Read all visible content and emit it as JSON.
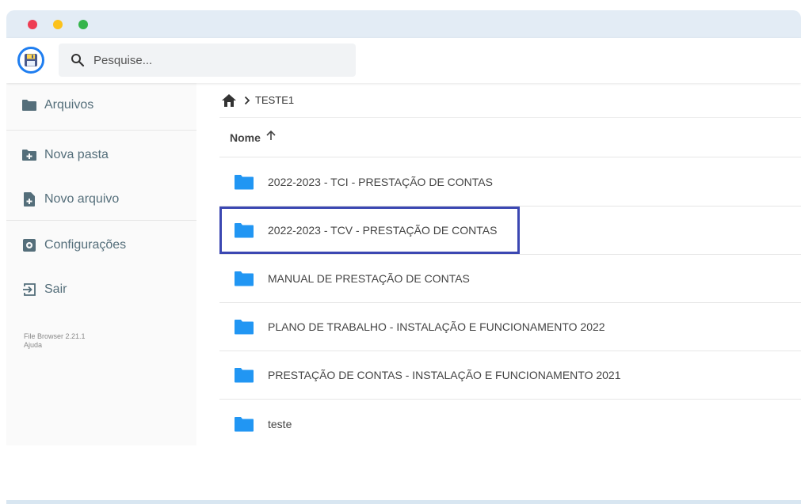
{
  "window": {
    "controls": [
      "close",
      "minimize",
      "maximize"
    ]
  },
  "header": {
    "logo_icon": "floppy-disk-icon",
    "search": {
      "icon": "search-icon",
      "placeholder": "Pesquise...",
      "value": ""
    }
  },
  "sidebar": {
    "items": [
      {
        "label": "Arquivos",
        "icon": "folder-icon"
      },
      {
        "label": "Nova pasta",
        "icon": "new-folder-icon"
      },
      {
        "label": "Novo arquivo",
        "icon": "new-file-icon"
      },
      {
        "label": "Configurações",
        "icon": "settings-icon"
      },
      {
        "label": "Sair",
        "icon": "exit-icon"
      }
    ],
    "credits": {
      "version": "File Browser 2.21.1",
      "help": "Ajuda"
    }
  },
  "breadcrumbs": {
    "home_icon": "home-icon",
    "items": [
      "TESTE1"
    ]
  },
  "listing": {
    "sort_label": "Nome",
    "sort_icon": "arrow-up-icon",
    "rows": [
      {
        "name": "2022-2023 - TCI - PRESTAÇÃO DE CONTAS",
        "icon": "folder-icon"
      },
      {
        "name": "2022-2023 - TCV - PRESTAÇÃO DE CONTAS",
        "icon": "folder-icon",
        "highlighted": true
      },
      {
        "name": "MANUAL DE PRESTAÇÃO DE CONTAS",
        "icon": "folder-icon"
      },
      {
        "name": "PLANO DE TRABALHO - INSTALAÇÃO E FUNCIONAMENTO 2022",
        "icon": "folder-icon"
      },
      {
        "name": "PRESTAÇÃO DE CONTAS - INSTALAÇÃO E FUNCIONAMENTO 2021",
        "icon": "folder-icon"
      },
      {
        "name": "teste",
        "icon": "folder-icon"
      }
    ]
  },
  "colors": {
    "accent": "#1f7ef0",
    "folder": "#2196f3",
    "highlight_border": "#3b47b2",
    "sidebar_icon": "#546e7a"
  }
}
